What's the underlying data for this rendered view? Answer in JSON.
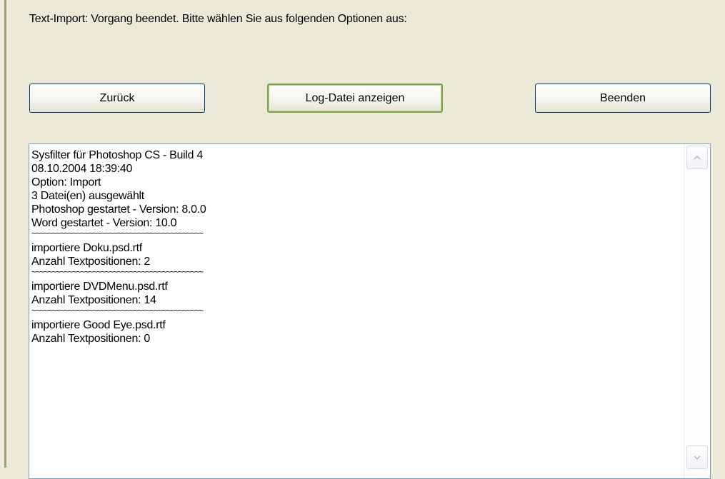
{
  "header": {
    "message": "Text-Import: Vorgang beendet. Bitte wählen Sie aus folgenden Optionen aus:"
  },
  "buttons": {
    "back": "Zurück",
    "show_log": "Log-Datei anzeigen",
    "exit": "Beenden"
  },
  "log": {
    "lines": [
      {
        "type": "text",
        "text": "Sysfilter für Photoshop CS - Build 4"
      },
      {
        "type": "text",
        "text": "08.10.2004 18:39:40"
      },
      {
        "type": "text",
        "text": "Option: Import"
      },
      {
        "type": "text",
        "text": "3 Datei(en) ausgewählt"
      },
      {
        "type": "text",
        "text": "Photoshop gestartet - Version: 8.0.0"
      },
      {
        "type": "text",
        "text": "Word gestartet - Version: 10.0"
      },
      {
        "type": "sep",
        "text": "~~~~~~~~~~~~~~~~~~~~~~~~~~~~~~~~~~~~~~~~~~"
      },
      {
        "type": "text",
        "text": "importiere Doku.psd.rtf"
      },
      {
        "type": "text",
        "text": "Anzahl Textpositionen: 2"
      },
      {
        "type": "sep",
        "text": "~~~~~~~~~~~~~~~~~~~~~~~~~~~~~~~~~~~~~~~~~~"
      },
      {
        "type": "text",
        "text": "importiere DVDMenu.psd.rtf"
      },
      {
        "type": "text",
        "text": "Anzahl Textpositionen: 14"
      },
      {
        "type": "sep",
        "text": "~~~~~~~~~~~~~~~~~~~~~~~~~~~~~~~~~~~~~~~~~~"
      },
      {
        "type": "text",
        "text": "importiere Good Eye.psd.rtf"
      },
      {
        "type": "text",
        "text": "Anzahl Textpositionen: 0"
      }
    ]
  },
  "icons": {
    "scroll_up": "chevron-up-icon",
    "scroll_down": "chevron-down-icon"
  },
  "colors": {
    "background": "#ece9d8",
    "default_button_border": "#7aa24a",
    "text_border": "#7f9db9"
  }
}
